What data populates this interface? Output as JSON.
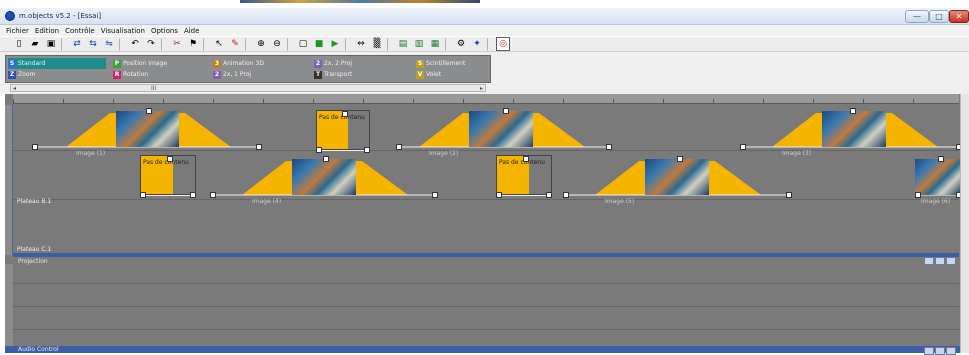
{
  "window": {
    "title": "m.objects v5.2 - [Essai]",
    "min": "—",
    "max": "□",
    "close": "✕"
  },
  "menu": [
    "Fichier",
    "Edition",
    "Contrôle",
    "Visualisation",
    "Options",
    "Aide"
  ],
  "toolbar": {
    "icons": [
      "new-icon",
      "open-icon",
      "save-icon",
      "sep",
      "track-icon",
      "track-add-icon",
      "track-remove-icon",
      "sep",
      "undo-icon",
      "redo-icon",
      "sep",
      "cut-icon",
      "marker-icon",
      "sep",
      "pointer-icon",
      "pen-icon",
      "sep",
      "zoom-in-icon",
      "zoom-out-icon",
      "sep",
      "frame-icon",
      "stop-icon",
      "play-icon",
      "sep",
      "loop-icon",
      "disabled-icon",
      "sep",
      "screen-icon",
      "screen-alt-icon",
      "screen-alt2-icon",
      "sep",
      "settings-icon",
      "wand-icon",
      "sep",
      "preview-icon"
    ],
    "glyphs": [
      "▯",
      "▰",
      "▣",
      "",
      "⇄",
      "⇆",
      "⇋",
      "",
      "↶",
      "↷",
      "",
      "✂",
      "⚑",
      "",
      "↖",
      "✎",
      "",
      "⊕",
      "⊖",
      "",
      "▢",
      "■",
      "▶",
      "",
      "⇔",
      "▒",
      "",
      "▤",
      "▥",
      "▦",
      "",
      "⚙",
      "✦",
      "",
      "◎"
    ]
  },
  "effects": {
    "items": [
      {
        "label": "Standard",
        "icon": "S"
      },
      {
        "label": "Zoom",
        "icon": "Z"
      },
      {
        "label": "Position Image",
        "icon": "P"
      },
      {
        "label": "Rotation",
        "icon": "R"
      },
      {
        "label": "Animation 3D",
        "icon": "3"
      },
      {
        "label": "2x, 1 Proj",
        "icon": "2"
      },
      {
        "label": "2x, 2 Proj",
        "icon": "2"
      },
      {
        "label": "Transport",
        "icon": "T"
      },
      {
        "label": "Scintillement",
        "icon": "S"
      },
      {
        "label": "Volet",
        "icon": "V"
      }
    ],
    "scroll_label": "III"
  },
  "timeline": {
    "lane_labels": [
      "Plateau B.1",
      "Plateau C.1"
    ],
    "clips": [
      {
        "label": "Image (1)"
      },
      {
        "label": "Pas de contenu"
      },
      {
        "label": "Image (2)"
      },
      {
        "label": "Image (3)"
      },
      {
        "label": "Pas de contenu"
      },
      {
        "label": "Image (4)"
      },
      {
        "label": "Pas de contenu"
      },
      {
        "label": "Image (5)"
      },
      {
        "label": "Image (6)"
      }
    ]
  },
  "panes": {
    "projection": "Projection",
    "audio": "Audio Control"
  },
  "colors": {
    "clip_fill": "#f5b400",
    "lane_bg": "#7a7a7a",
    "accent_blue": "#3a5fa6",
    "title_bg": "#dbe6f4",
    "close_red": "#c4321e"
  }
}
